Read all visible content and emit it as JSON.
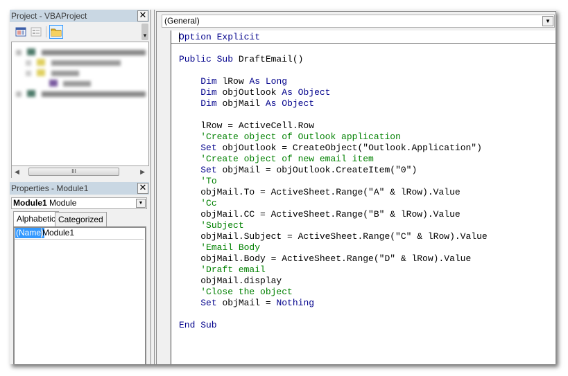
{
  "project_panel": {
    "title": "Project - VBAProject",
    "toolbar": [
      {
        "name": "view-code-icon",
        "active": false
      },
      {
        "name": "view-object-icon",
        "active": false,
        "disabled": true
      },
      {
        "name": "toggle-folders-icon",
        "active": true
      }
    ],
    "tree_note": "tree contents blurred in screenshot"
  },
  "properties_panel": {
    "title": "Properties - Module1",
    "object_selector": {
      "name": "Module1",
      "type": "Module"
    },
    "tabs": [
      {
        "label": "Alphabetic",
        "selected": true
      },
      {
        "label": "Categorized",
        "selected": false
      }
    ],
    "rows": [
      {
        "name": "(Name)",
        "value": "Module1"
      }
    ]
  },
  "code_window": {
    "procedure_selector": "(General)",
    "colors": {
      "keyword": "#00008b",
      "comment": "#008000",
      "text": "#000000"
    },
    "declarations": [
      [
        {
          "t": "kw",
          "s": "Option Explicit"
        }
      ]
    ],
    "lines": [
      [],
      [
        {
          "t": "kw",
          "s": "Public Sub "
        },
        {
          "t": "tx",
          "s": "DraftEmail()"
        }
      ],
      [],
      [
        {
          "t": "tx",
          "s": "    "
        },
        {
          "t": "kw",
          "s": "Dim "
        },
        {
          "t": "tx",
          "s": "lRow "
        },
        {
          "t": "kw",
          "s": "As Long"
        }
      ],
      [
        {
          "t": "tx",
          "s": "    "
        },
        {
          "t": "kw",
          "s": "Dim "
        },
        {
          "t": "tx",
          "s": "objOutlook "
        },
        {
          "t": "kw",
          "s": "As Object"
        }
      ],
      [
        {
          "t": "tx",
          "s": "    "
        },
        {
          "t": "kw",
          "s": "Dim "
        },
        {
          "t": "tx",
          "s": "objMail "
        },
        {
          "t": "kw",
          "s": "As Object"
        }
      ],
      [],
      [
        {
          "t": "tx",
          "s": "    lRow = ActiveCell.Row"
        }
      ],
      [
        {
          "t": "tx",
          "s": "    "
        },
        {
          "t": "cm",
          "s": "'Create object of Outlook application"
        }
      ],
      [
        {
          "t": "tx",
          "s": "    "
        },
        {
          "t": "kw",
          "s": "Set "
        },
        {
          "t": "tx",
          "s": "objOutlook = CreateObject(\"Outlook.Application\")"
        }
      ],
      [
        {
          "t": "tx",
          "s": "    "
        },
        {
          "t": "cm",
          "s": "'Create object of new email item"
        }
      ],
      [
        {
          "t": "tx",
          "s": "    "
        },
        {
          "t": "kw",
          "s": "Set "
        },
        {
          "t": "tx",
          "s": "objMail = objOutlook.CreateItem(\"0\")"
        }
      ],
      [
        {
          "t": "tx",
          "s": "    "
        },
        {
          "t": "cm",
          "s": "'To"
        }
      ],
      [
        {
          "t": "tx",
          "s": "    objMail.To = ActiveSheet.Range(\"A\" & lRow).Value"
        }
      ],
      [
        {
          "t": "tx",
          "s": "    "
        },
        {
          "t": "cm",
          "s": "'Cc"
        }
      ],
      [
        {
          "t": "tx",
          "s": "    objMail.CC = ActiveSheet.Range(\"B\" & lRow).Value"
        }
      ],
      [
        {
          "t": "tx",
          "s": "    "
        },
        {
          "t": "cm",
          "s": "'Subject"
        }
      ],
      [
        {
          "t": "tx",
          "s": "    objMail.Subject = ActiveSheet.Range(\"C\" & lRow).Value"
        }
      ],
      [
        {
          "t": "tx",
          "s": "    "
        },
        {
          "t": "cm",
          "s": "'Email Body"
        }
      ],
      [
        {
          "t": "tx",
          "s": "    objMail.Body = ActiveSheet.Range(\"D\" & lRow).Value"
        }
      ],
      [
        {
          "t": "tx",
          "s": "    "
        },
        {
          "t": "cm",
          "s": "'Draft email"
        }
      ],
      [
        {
          "t": "tx",
          "s": "    objMail.display"
        }
      ],
      [
        {
          "t": "tx",
          "s": "    "
        },
        {
          "t": "cm",
          "s": "'Close the object"
        }
      ],
      [
        {
          "t": "tx",
          "s": "    "
        },
        {
          "t": "kw",
          "s": "Set "
        },
        {
          "t": "tx",
          "s": "objMail = "
        },
        {
          "t": "kw",
          "s": "Nothing"
        }
      ],
      [],
      [
        {
          "t": "kw",
          "s": "End Sub"
        }
      ]
    ]
  }
}
